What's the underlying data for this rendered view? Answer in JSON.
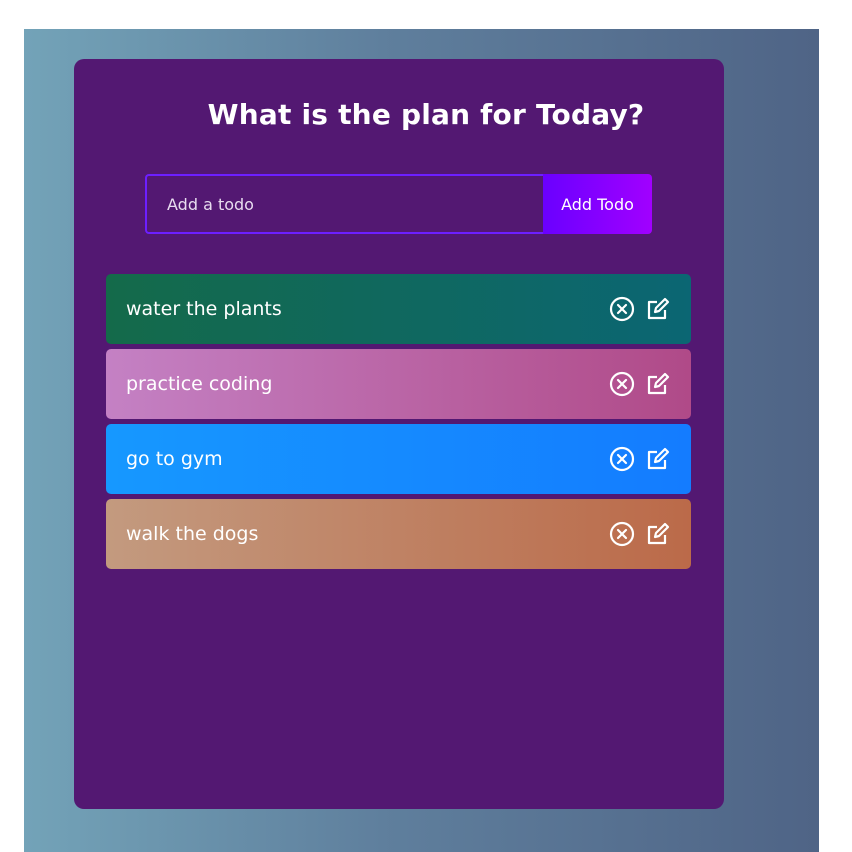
{
  "header": {
    "title": "What is the plan for Today?"
  },
  "form": {
    "placeholder": "Add a todo",
    "value": "",
    "button_label": "Add Todo"
  },
  "todos": [
    {
      "text": "water the plants",
      "gradient": [
        "#146a4a",
        "#0b6673"
      ]
    },
    {
      "text": "practice coding",
      "gradient": [
        "#c481c4",
        "#b04a88"
      ]
    },
    {
      "text": "go to gym",
      "gradient": [
        "#1698ff",
        "#147cff"
      ]
    },
    {
      "text": "walk the dogs",
      "gradient": [
        "#c39a7f",
        "#bb6a49"
      ]
    }
  ],
  "icons": {
    "delete": "close-circle-icon",
    "edit": "edit-icon"
  },
  "colors": {
    "app_background": "#531872",
    "accent": "#6d1fff",
    "button_gradient": [
      "#6a00ff",
      "#a100ff"
    ]
  }
}
